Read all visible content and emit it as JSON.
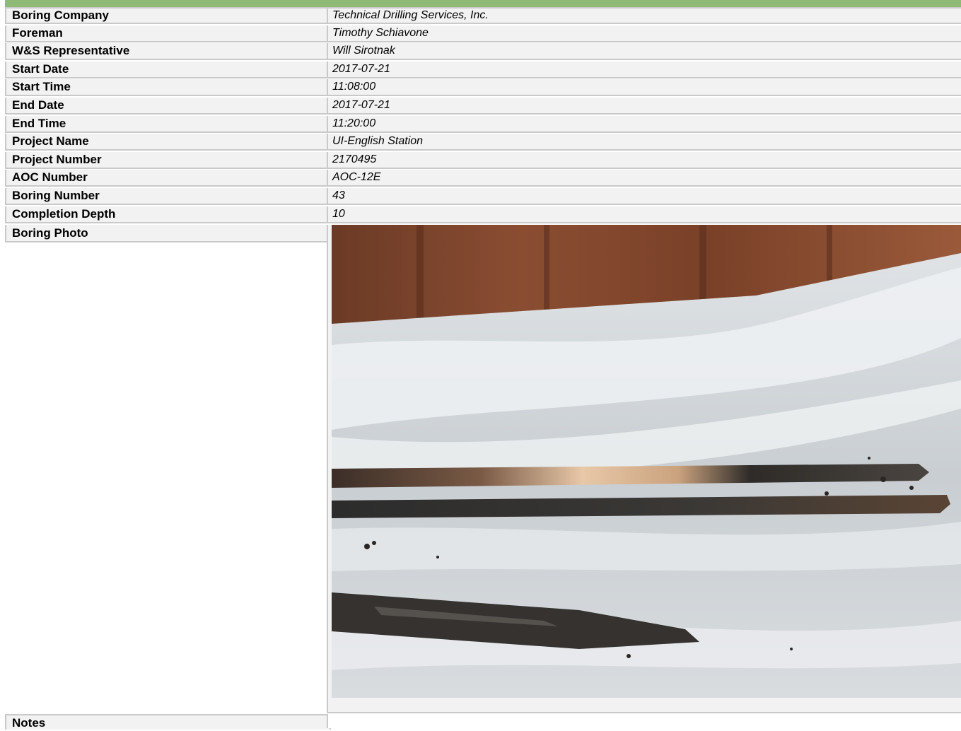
{
  "fields": [
    {
      "label": "Boring Company",
      "value": "Technical Drilling Services, Inc."
    },
    {
      "label": "Foreman",
      "value": "Timothy Schiavone"
    },
    {
      "label": "W&S Representative",
      "value": "Will Sirotnak"
    },
    {
      "label": "Start Date",
      "value": "2017-07-21"
    },
    {
      "label": "Start Time",
      "value": "11:08:00"
    },
    {
      "label": "End Date",
      "value": "2017-07-21"
    },
    {
      "label": "End Time",
      "value": "11:20:00"
    },
    {
      "label": "Project Name",
      "value": "UI-English Station"
    },
    {
      "label": "Project Number",
      "value": "2170495"
    },
    {
      "label": "AOC Number",
      "value": "AOC-12E"
    },
    {
      "label": "Boring Number",
      "value": "43"
    },
    {
      "label": "Completion Depth",
      "value": "10"
    }
  ],
  "photo": {
    "label": "Boring Photo"
  },
  "notes": {
    "label": "Notes"
  },
  "colors": {
    "header_bar": "#8fba75",
    "cell_bg": "#f2f2f2",
    "border": "#c9c9c9"
  }
}
